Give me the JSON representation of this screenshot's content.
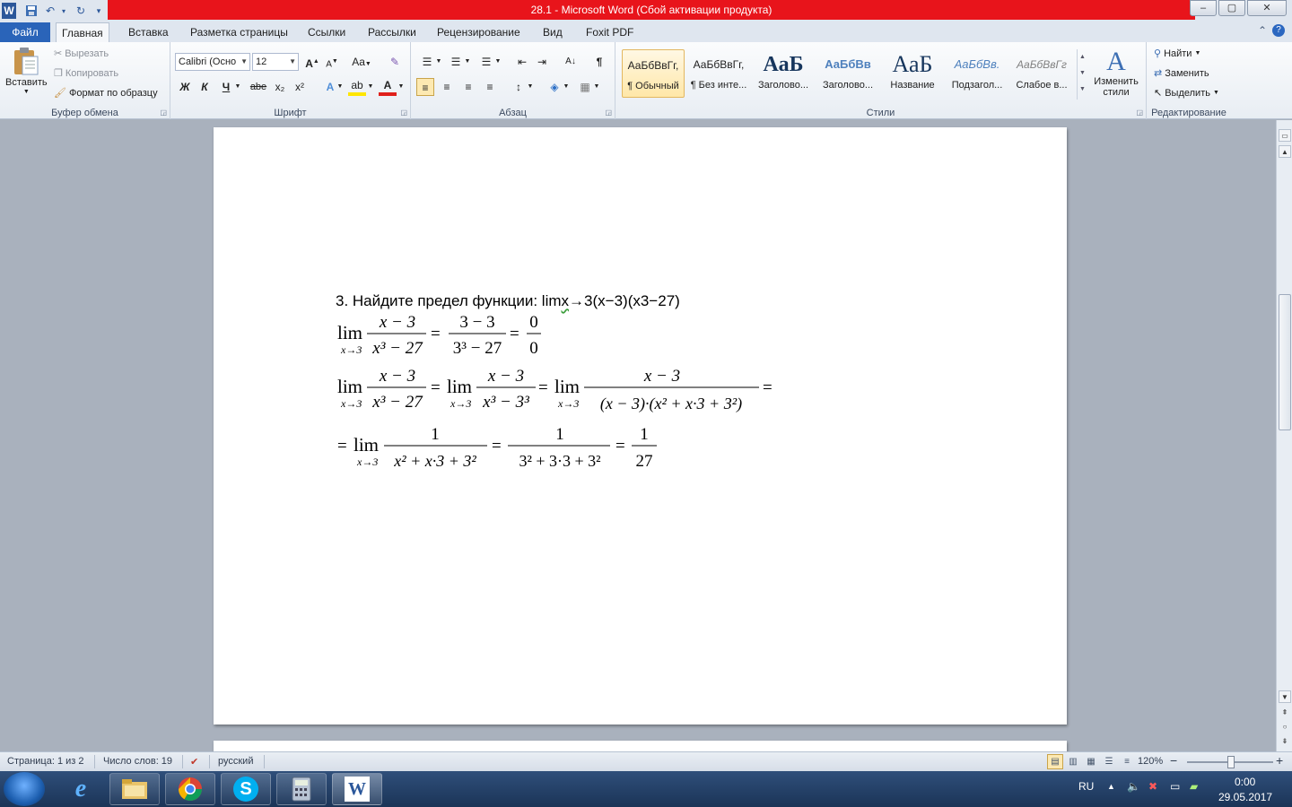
{
  "window": {
    "title": "28.1  -  Microsoft Word (Сбой активации продукта)",
    "controls": {
      "minimize": "–",
      "maximize": "▢",
      "close": "✕"
    }
  },
  "qat": {
    "word_icon": "W",
    "save_icon": "save-icon",
    "undo_icon": "↶",
    "redo_icon": "↻",
    "customize_icon": "▾"
  },
  "tabs": {
    "file": "Файл",
    "items": [
      "Главная",
      "Вставка",
      "Разметка страницы",
      "Ссылки",
      "Рассылки",
      "Рецензирование",
      "Вид",
      "Foxit PDF"
    ],
    "active": "Главная"
  },
  "ribbon": {
    "clipboard": {
      "label": "Буфер обмена",
      "paste": "Вставить",
      "cut": "Вырезать",
      "copy": "Копировать",
      "format_painter": "Формат по образцу"
    },
    "font": {
      "label": "Шрифт",
      "font_name": "Calibri (Осно",
      "font_size": "12",
      "grow": "A",
      "shrink": "A",
      "case": "Aa",
      "clear": "✎",
      "bold": "Ж",
      "italic": "К",
      "underline": "Ч",
      "strike": "abe",
      "subscript": "x₂",
      "superscript": "x²",
      "effects": "A",
      "highlight": "ab",
      "color": "A"
    },
    "paragraph": {
      "label": "Абзац",
      "bullets": "☰",
      "numbering": "☰",
      "multilevel": "☰",
      "decrease_indent": "⇤",
      "increase_indent": "⇥",
      "sort": "A↓",
      "pilcrow": "¶",
      "align_left": "≡",
      "center": "≡",
      "align_right": "≡",
      "justify": "≡",
      "line_spacing": "↕",
      "shading": "◈",
      "borders": "▦"
    },
    "styles": {
      "label": "Стили",
      "items": [
        {
          "sample": "АаБбВвГг,",
          "name": "¶ Обычный"
        },
        {
          "sample": "АаБбВвГг,",
          "name": "¶ Без инте..."
        },
        {
          "sample": "АаБ",
          "name": "Заголово..."
        },
        {
          "sample": "АаБбВв",
          "name": "Заголово..."
        },
        {
          "sample": "АаБ",
          "name": "Название"
        },
        {
          "sample": "АаБбВв.",
          "name": "Подзагол..."
        },
        {
          "sample": "АаБбВвГг",
          "name": "Слабое в..."
        }
      ],
      "change_styles": "Изменить стили"
    },
    "editing": {
      "label": "Редактирование",
      "find": "Найти",
      "replace": "Заменить",
      "select": "Выделить"
    }
  },
  "document": {
    "question_prefix": "3. Найдите предел функции: lim",
    "question_x": "x",
    "question_suffix": "→3(x−3)(x3−27)",
    "equations": {
      "lim": "lim",
      "sub": "x→3",
      "line1": {
        "num1": "x − 3",
        "den1": "x³ − 27",
        "num2": "3 − 3",
        "den2": "3³ − 27",
        "num3": "0",
        "den3": "0"
      },
      "line2": {
        "num1": "x − 3",
        "den1": "x³ − 27",
        "num2": "x − 3",
        "den2": "x³ − 3³",
        "num3": "x − 3",
        "den3": "(x − 3)·(x² + x·3 + 3²)"
      },
      "line3": {
        "num1": "1",
        "den1": "x² + x·3 + 3²",
        "num2": "1",
        "den2": "3² + 3·3 + 3²",
        "num3": "1",
        "den3": "27"
      }
    }
  },
  "statusbar": {
    "page": "Страница: 1 из 2",
    "words": "Число слов: 19",
    "language": "русский",
    "zoom": "120%",
    "zoom_minus": "−",
    "zoom_plus": "+"
  },
  "taskbar": {
    "apps": [
      "internet-explorer",
      "file-explorer",
      "chrome",
      "skype",
      "calculator",
      "word"
    ],
    "lang": "RU",
    "time": "0:00",
    "date": "29.05.2017"
  }
}
